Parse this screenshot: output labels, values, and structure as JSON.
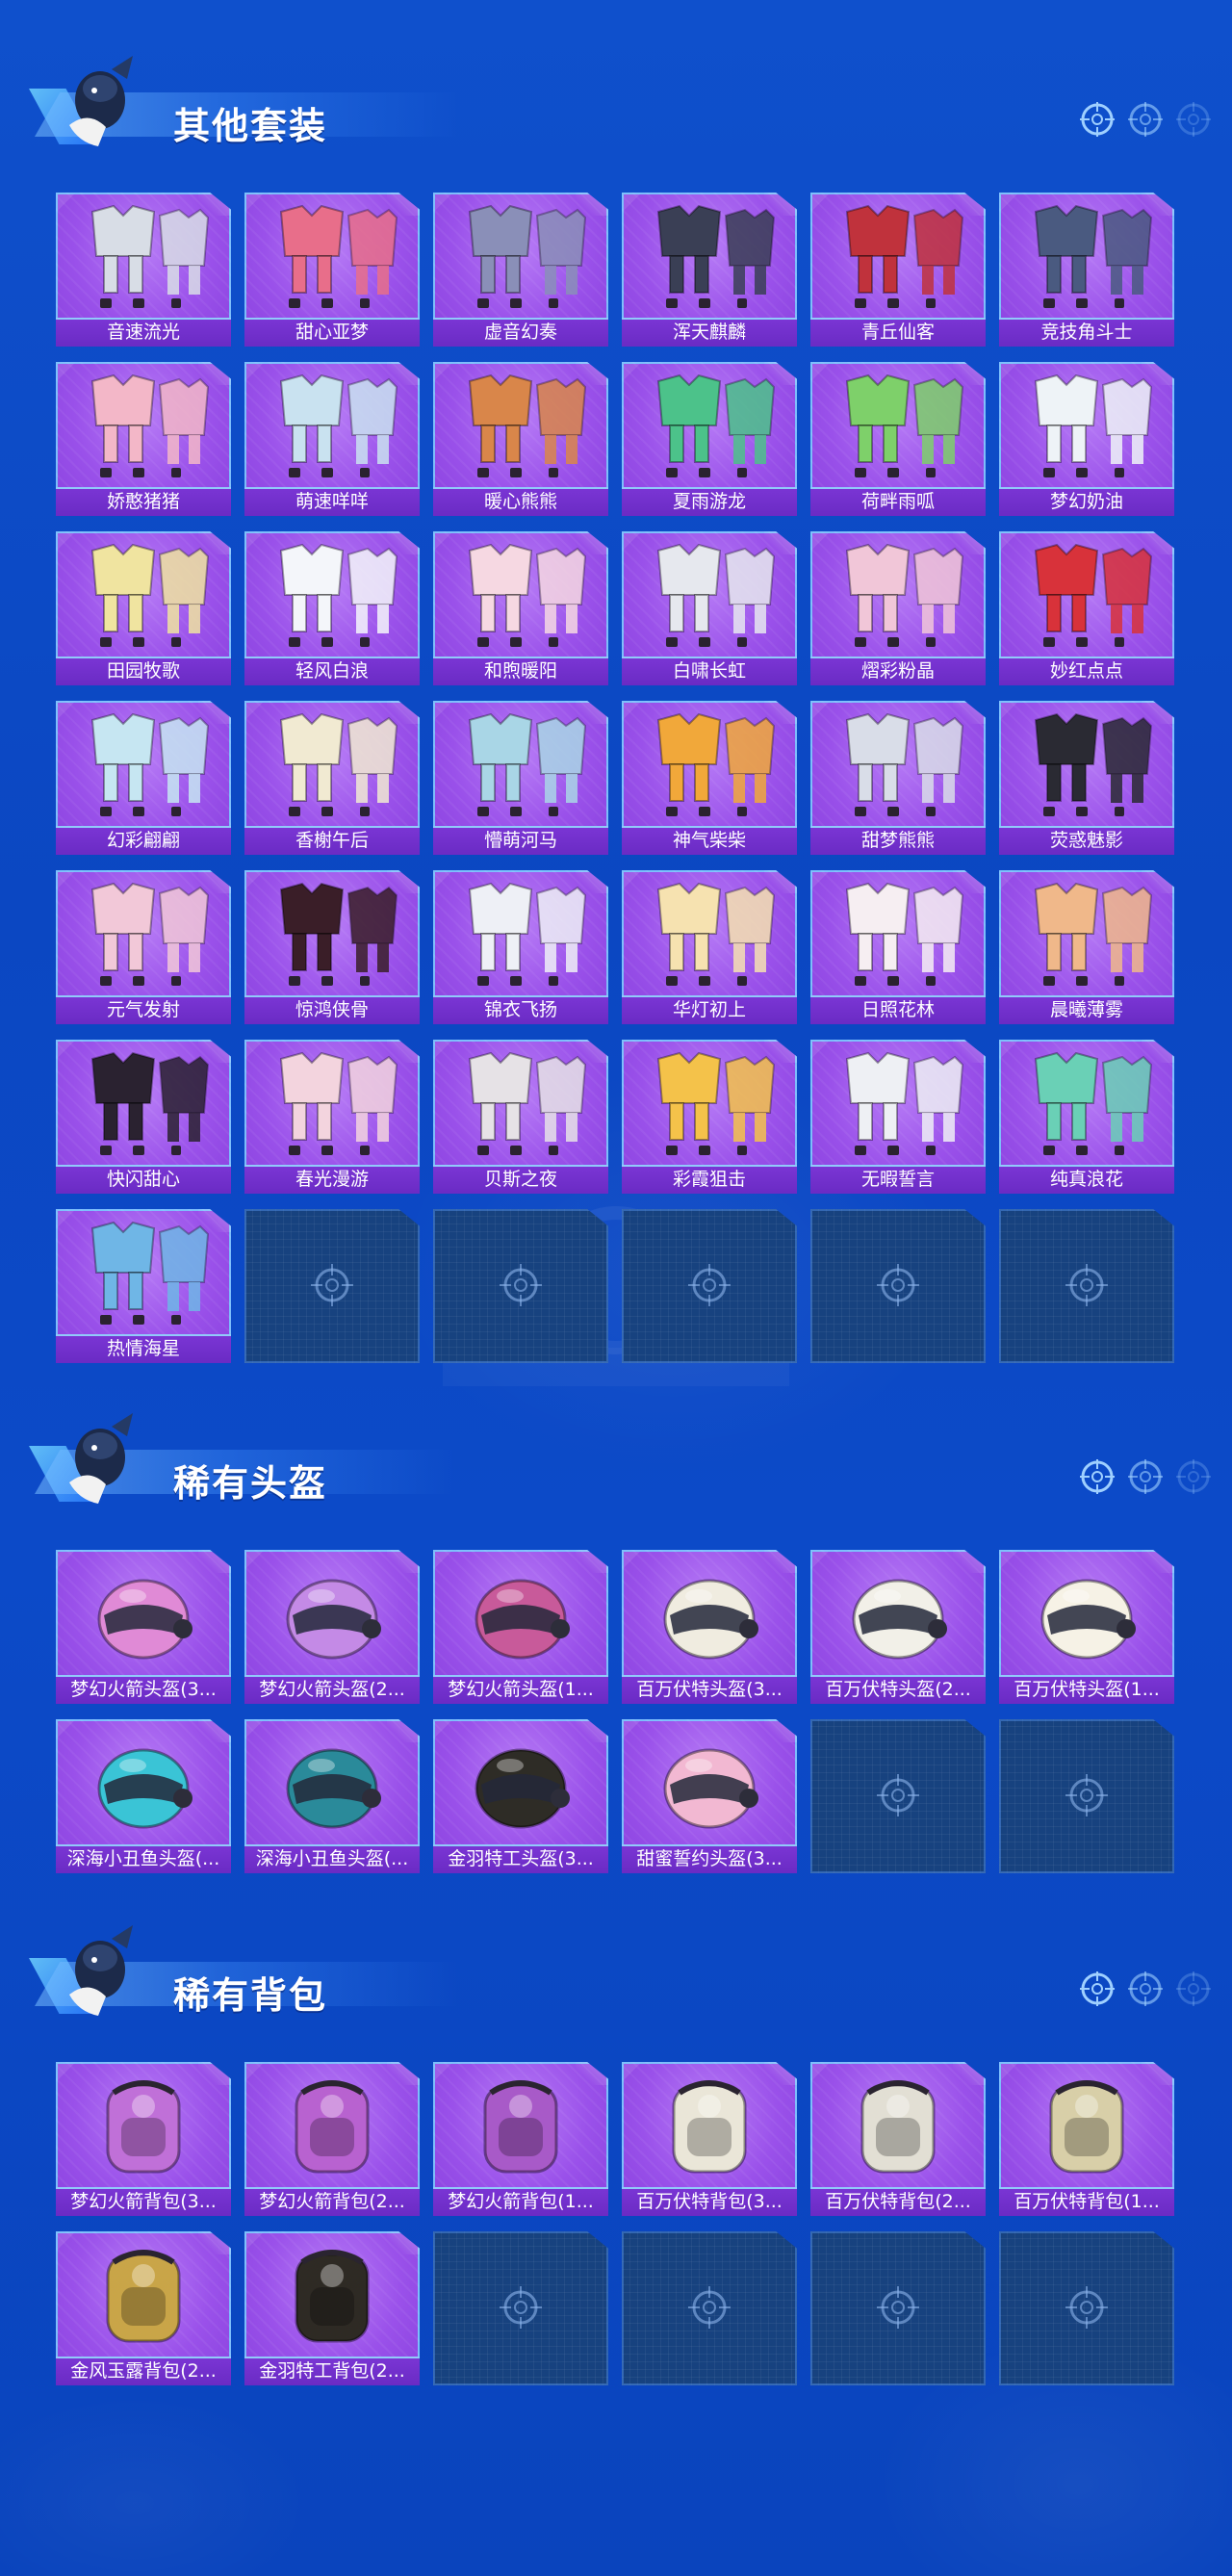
{
  "sections": [
    {
      "title": "其他套装",
      "kind": "outfit",
      "items": [
        {
          "name": "音速流光",
          "color": "#d8dde6"
        },
        {
          "name": "甜心亚梦",
          "color": "#e86e8a"
        },
        {
          "name": "虚音幻奏",
          "color": "#8a8fb8"
        },
        {
          "name": "浑天麒麟",
          "color": "#3a3f55"
        },
        {
          "name": "青丘仙客",
          "color": "#c0323c"
        },
        {
          "name": "竞技角斗士",
          "color": "#4a5a80"
        },
        {
          "name": "娇憨猪猪",
          "color": "#f3b7c8"
        },
        {
          "name": "萌速咩咩",
          "color": "#c9e2f0"
        },
        {
          "name": "暖心熊熊",
          "color": "#d9864a"
        },
        {
          "name": "夏雨游龙",
          "color": "#4cc28a"
        },
        {
          "name": "荷畔雨呱",
          "color": "#7ed06a"
        },
        {
          "name": "梦幻奶油",
          "color": "#eef3f7"
        },
        {
          "name": "田园牧歌",
          "color": "#f0e4a0"
        },
        {
          "name": "轻风白浪",
          "color": "#f4f6fa"
        },
        {
          "name": "和煦暖阳",
          "color": "#f6d8e2"
        },
        {
          "name": "白啸长虹",
          "color": "#e6e8ee"
        },
        {
          "name": "熠彩粉晶",
          "color": "#f1c6d8"
        },
        {
          "name": "妙红点点",
          "color": "#d8323a"
        },
        {
          "name": "幻彩翩翩",
          "color": "#c6e6f2"
        },
        {
          "name": "香榭午后",
          "color": "#f1ead2"
        },
        {
          "name": "懵萌河马",
          "color": "#a9d6e6"
        },
        {
          "name": "神气柴柴",
          "color": "#f1a83a"
        },
        {
          "name": "甜梦熊熊",
          "color": "#d9dde8"
        },
        {
          "name": "荧惑魅影",
          "color": "#2a2a33"
        },
        {
          "name": "元气发射",
          "color": "#f2c8d8"
        },
        {
          "name": "惊鸿侠骨",
          "color": "#3a1e28"
        },
        {
          "name": "锦衣飞扬",
          "color": "#eef0f6"
        },
        {
          "name": "华灯初上",
          "color": "#f6e2b0"
        },
        {
          "name": "日照花林",
          "color": "#f6eef2"
        },
        {
          "name": "晨曦薄雾",
          "color": "#f0b88a"
        },
        {
          "name": "快闪甜心",
          "color": "#2a2230"
        },
        {
          "name": "春光漫游",
          "color": "#f3d4de"
        },
        {
          "name": "贝斯之夜",
          "color": "#e6e2e6"
        },
        {
          "name": "彩霞狙击",
          "color": "#f4c24a"
        },
        {
          "name": "无暇誓言",
          "color": "#eef0f4"
        },
        {
          "name": "纯真浪花",
          "color": "#6ad0b6"
        },
        {
          "name": "热情海星",
          "color": "#6fb6e6"
        }
      ],
      "slots": 42
    },
    {
      "title": "稀有头盔",
      "kind": "helmet",
      "items": [
        {
          "name": "梦幻火箭头盔(3...",
          "color": "#e08ad6"
        },
        {
          "name": "梦幻火箭头盔(2...",
          "color": "#c48ae6"
        },
        {
          "name": "梦幻火箭头盔(1...",
          "color": "#c85a9a"
        },
        {
          "name": "百万伏特头盔(3...",
          "color": "#f0ece0"
        },
        {
          "name": "百万伏特头盔(2...",
          "color": "#f2f0e8"
        },
        {
          "name": "百万伏特头盔(1...",
          "color": "#f6f2e6"
        },
        {
          "name": "深海小丑鱼头盔(...",
          "color": "#3ac4d6"
        },
        {
          "name": "深海小丑鱼头盔(...",
          "color": "#2a8a9a"
        },
        {
          "name": "金羽特工头盔(3...",
          "color": "#2e2c26"
        },
        {
          "name": "甜蜜誓约头盔(3...",
          "color": "#f2b8d2"
        }
      ],
      "slots": 12
    },
    {
      "title": "稀有背包",
      "kind": "backpack",
      "items": [
        {
          "name": "梦幻火箭背包(3...",
          "color": "#c070d8"
        },
        {
          "name": "梦幻火箭背包(2...",
          "color": "#b862d0"
        },
        {
          "name": "梦幻火箭背包(1...",
          "color": "#a85ac8"
        },
        {
          "name": "百万伏特背包(3...",
          "color": "#eae6d8"
        },
        {
          "name": "百万伏特背包(2...",
          "color": "#e2dfd4"
        },
        {
          "name": "百万伏特背包(1...",
          "color": "#d8cfa8"
        },
        {
          "name": "金风玉露背包(2...",
          "color": "#c9a548"
        },
        {
          "name": "金羽特工背包(2...",
          "color": "#2e2a24"
        }
      ],
      "slots": 12
    }
  ]
}
